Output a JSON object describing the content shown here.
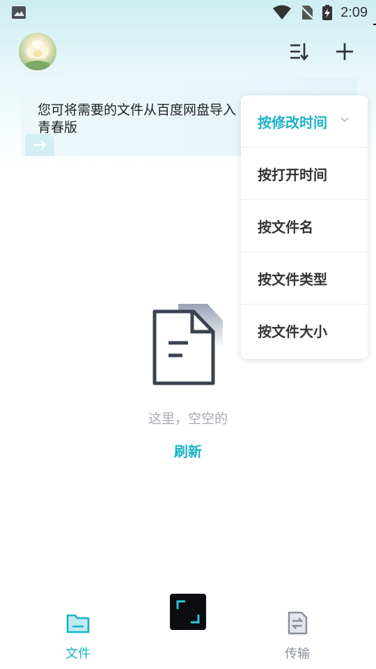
{
  "status_bar": {
    "time": "2:09"
  },
  "banner": {
    "text": "您可将需要的文件从百度网盘导入青春版"
  },
  "sort_menu": {
    "items": [
      {
        "label": "按修改时间",
        "active": true
      },
      {
        "label": "按打开时间",
        "active": false
      },
      {
        "label": "按文件名",
        "active": false
      },
      {
        "label": "按文件类型",
        "active": false
      },
      {
        "label": "按文件大小",
        "active": false
      }
    ]
  },
  "empty_state": {
    "message": "这里，空空的",
    "refresh_label": "刷新"
  },
  "bottom_nav": {
    "files_label": "文件",
    "transfer_label": "传输"
  },
  "colors": {
    "accent": "#1ab2c8",
    "muted_text": "#a6a9b0",
    "icon_dark": "#3b4250"
  },
  "icons": [
    "image-icon",
    "wifi-icon",
    "no-sim-icon",
    "battery-charging-icon",
    "sort-icon",
    "plus-icon",
    "arrow-right-icon",
    "empty-document-icon",
    "chevron-down-icon",
    "folder-icon",
    "transfer-icon",
    "scan-icon"
  ]
}
